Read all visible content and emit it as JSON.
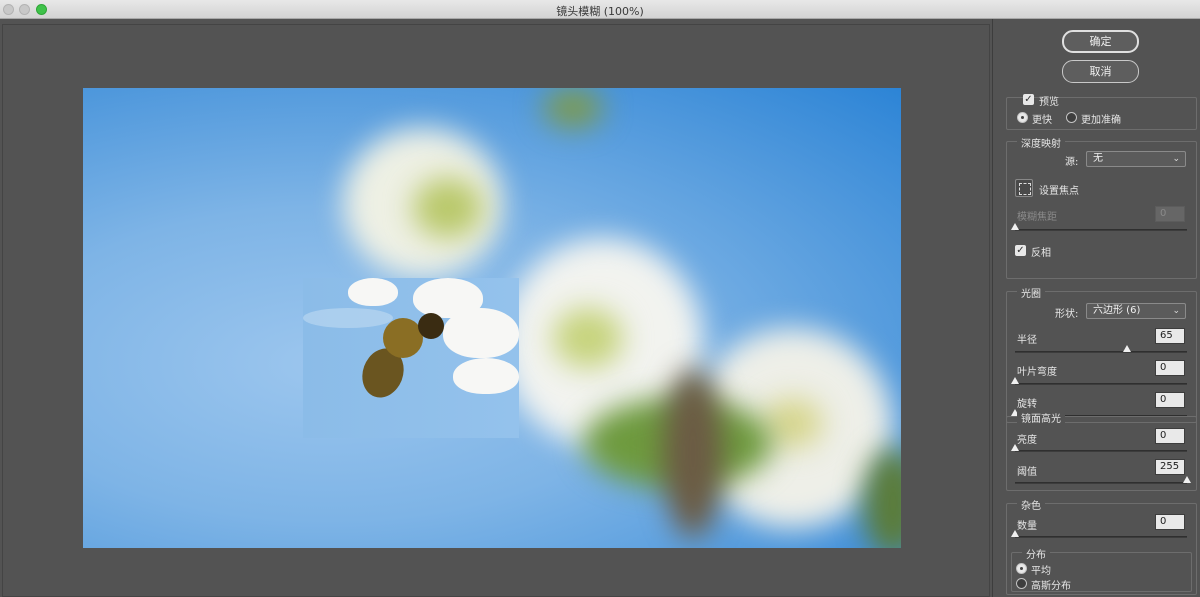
{
  "window": {
    "title": "镜头模糊 (100%)"
  },
  "actions": {
    "ok_label": "确定",
    "cancel_label": "取消"
  },
  "preview": {
    "checkbox_label": "预览",
    "checked": true,
    "faster_label": "更快",
    "accurate_label": "更加准确",
    "selected": "faster"
  },
  "depth_map": {
    "title": "深度映射",
    "source_label": "源:",
    "source_value": "无",
    "set_focus_label": "设置焦点",
    "blur_focal_label": "模糊焦距",
    "blur_focal_value": "0",
    "blur_focal_slider": 0,
    "invert_label": "反相",
    "invert_checked": true
  },
  "iris": {
    "title": "光圈",
    "shape_label": "形状:",
    "shape_value": "六边形 (6)",
    "radius_label": "半径",
    "radius_value": "65",
    "radius_slider": 0.65,
    "blade_label": "叶片弯度",
    "blade_value": "0",
    "blade_slider": 0,
    "rotation_label": "旋转",
    "rotation_value": "0",
    "rotation_slider": 0
  },
  "specular": {
    "title": "镜面高光",
    "brightness_label": "亮度",
    "brightness_value": "0",
    "brightness_slider": 0,
    "threshold_label": "阈值",
    "threshold_value": "255",
    "threshold_slider": 1
  },
  "noise": {
    "title": "杂色",
    "amount_label": "数量",
    "amount_value": "0",
    "amount_slider": 0,
    "distribution_title": "分布",
    "uniform_label": "平均",
    "gaussian_label": "高斯分布",
    "selected": "uniform"
  }
}
